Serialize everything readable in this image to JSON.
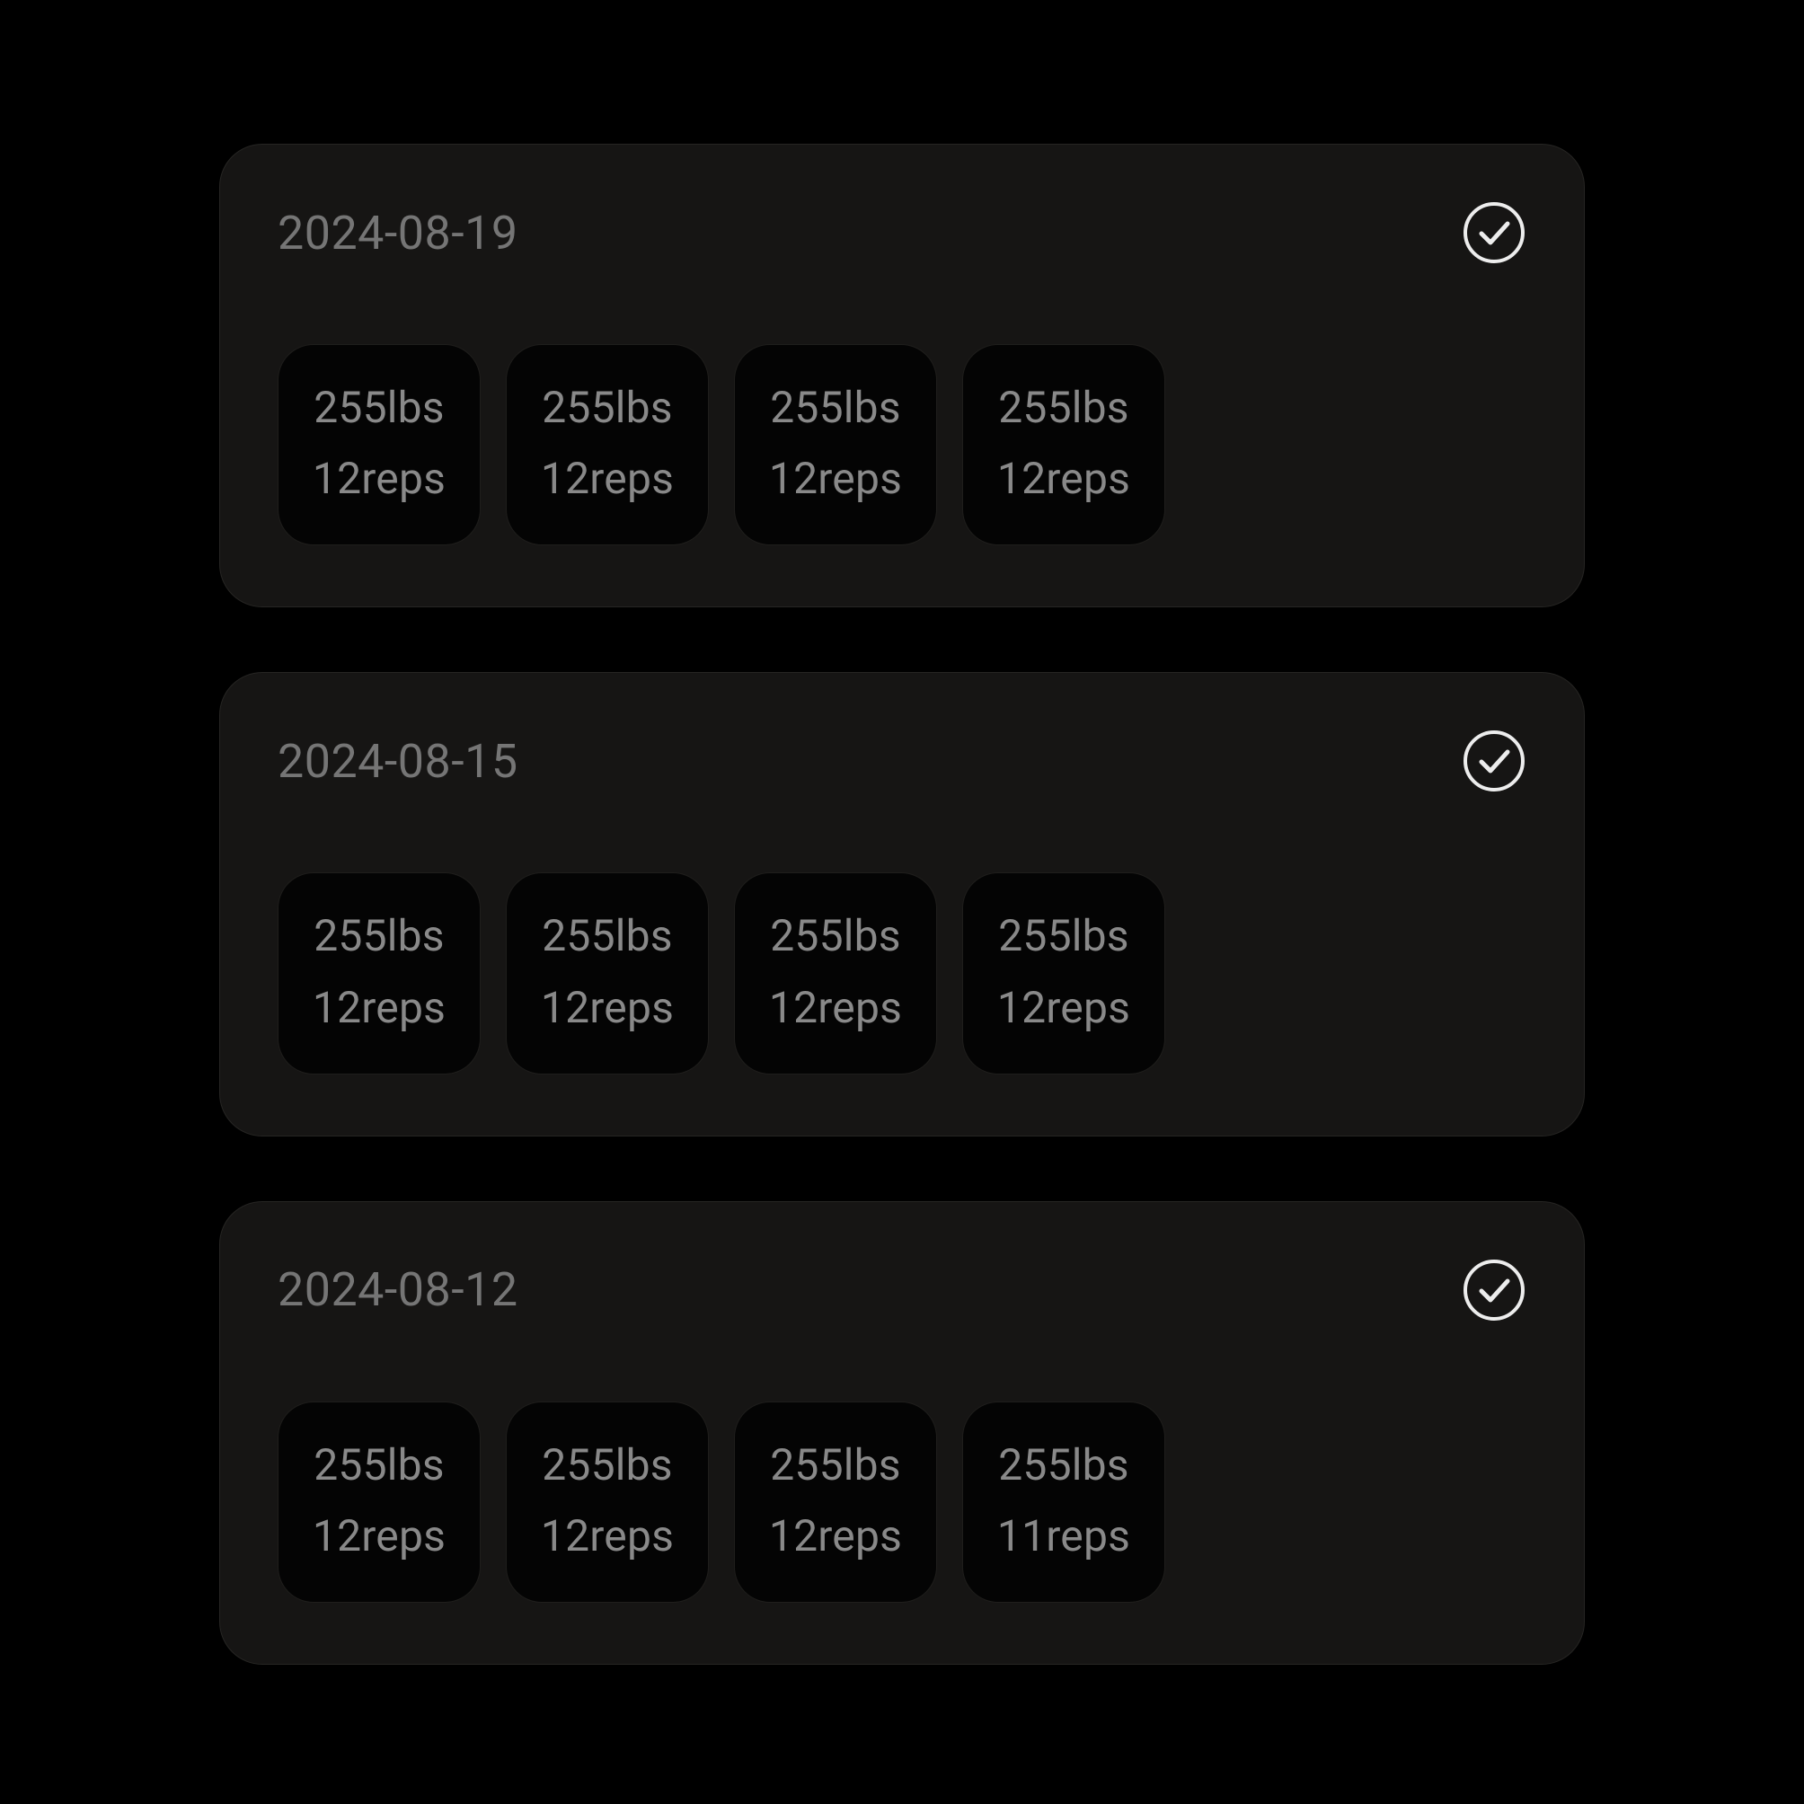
{
  "weight_unit": "lbs",
  "reps_unit": "reps",
  "entries": [
    {
      "date": "2024-08-19",
      "completed": true,
      "sets": [
        {
          "weight": "255",
          "reps": "12"
        },
        {
          "weight": "255",
          "reps": "12"
        },
        {
          "weight": "255",
          "reps": "12"
        },
        {
          "weight": "255",
          "reps": "12"
        }
      ]
    },
    {
      "date": "2024-08-15",
      "completed": true,
      "sets": [
        {
          "weight": "255",
          "reps": "12"
        },
        {
          "weight": "255",
          "reps": "12"
        },
        {
          "weight": "255",
          "reps": "12"
        },
        {
          "weight": "255",
          "reps": "12"
        }
      ]
    },
    {
      "date": "2024-08-12",
      "completed": true,
      "sets": [
        {
          "weight": "255",
          "reps": "12"
        },
        {
          "weight": "255",
          "reps": "12"
        },
        {
          "weight": "255",
          "reps": "12"
        },
        {
          "weight": "255",
          "reps": "11"
        }
      ]
    }
  ]
}
